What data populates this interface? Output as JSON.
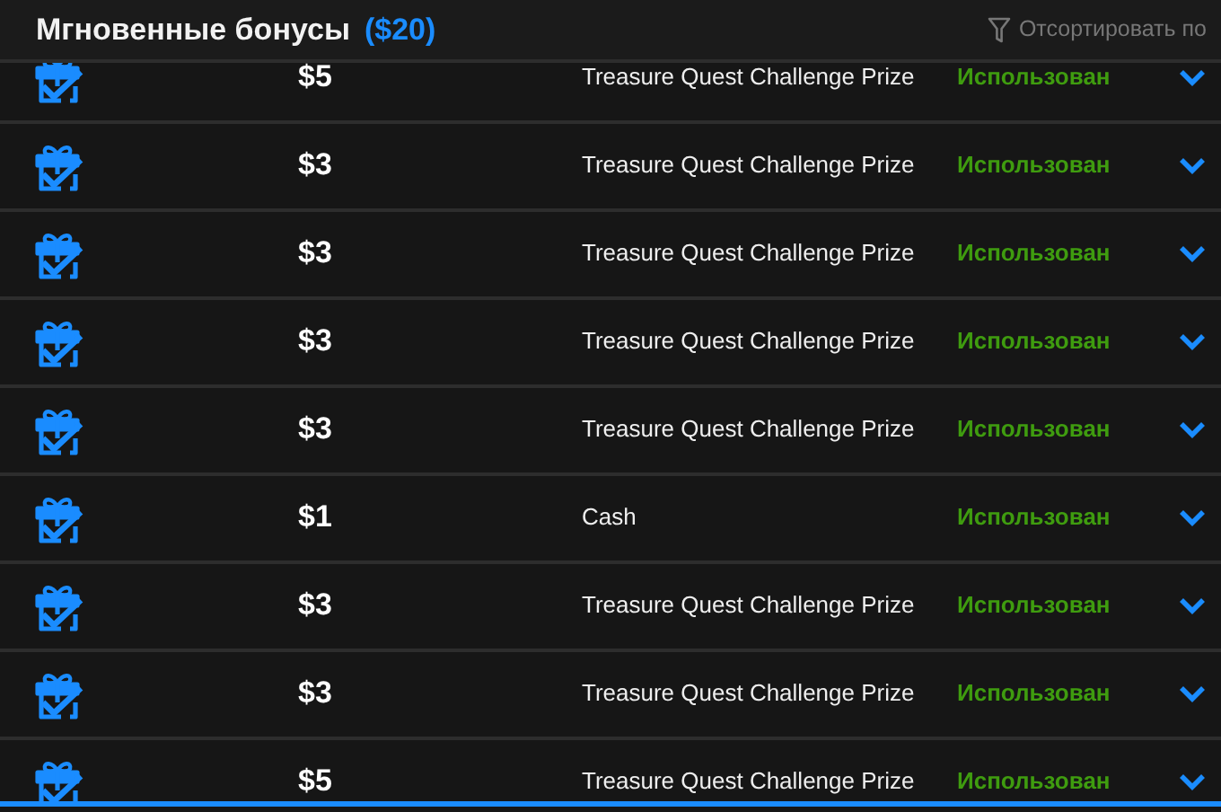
{
  "header": {
    "title": "Мгновенные бонусы",
    "total": "($20)",
    "sort_label": "Отсортировать по"
  },
  "bonuses": [
    {
      "amount": "$5",
      "description": "Treasure Quest Challenge Prize",
      "status": "Использован",
      "expanded": false
    },
    {
      "amount": "$3",
      "description": "Treasure Quest Challenge Prize",
      "status": "Использован",
      "expanded": false
    },
    {
      "amount": "$3",
      "description": "Treasure Quest Challenge Prize",
      "status": "Использован",
      "expanded": false
    },
    {
      "amount": "$3",
      "description": "Treasure Quest Challenge Prize",
      "status": "Использован",
      "expanded": false
    },
    {
      "amount": "$3",
      "description": "Treasure Quest Challenge Prize",
      "status": "Использован",
      "expanded": false
    },
    {
      "amount": "$1",
      "description": "Cash",
      "status": "Использован",
      "expanded": false
    },
    {
      "amount": "$3",
      "description": "Treasure Quest Challenge Prize",
      "status": "Использован",
      "expanded": false
    },
    {
      "amount": "$3",
      "description": "Treasure Quest Challenge Prize",
      "status": "Использован",
      "expanded": false
    },
    {
      "amount": "$5",
      "description": "Treasure Quest Challenge Prize",
      "status": "Использован",
      "expanded": false
    }
  ]
}
